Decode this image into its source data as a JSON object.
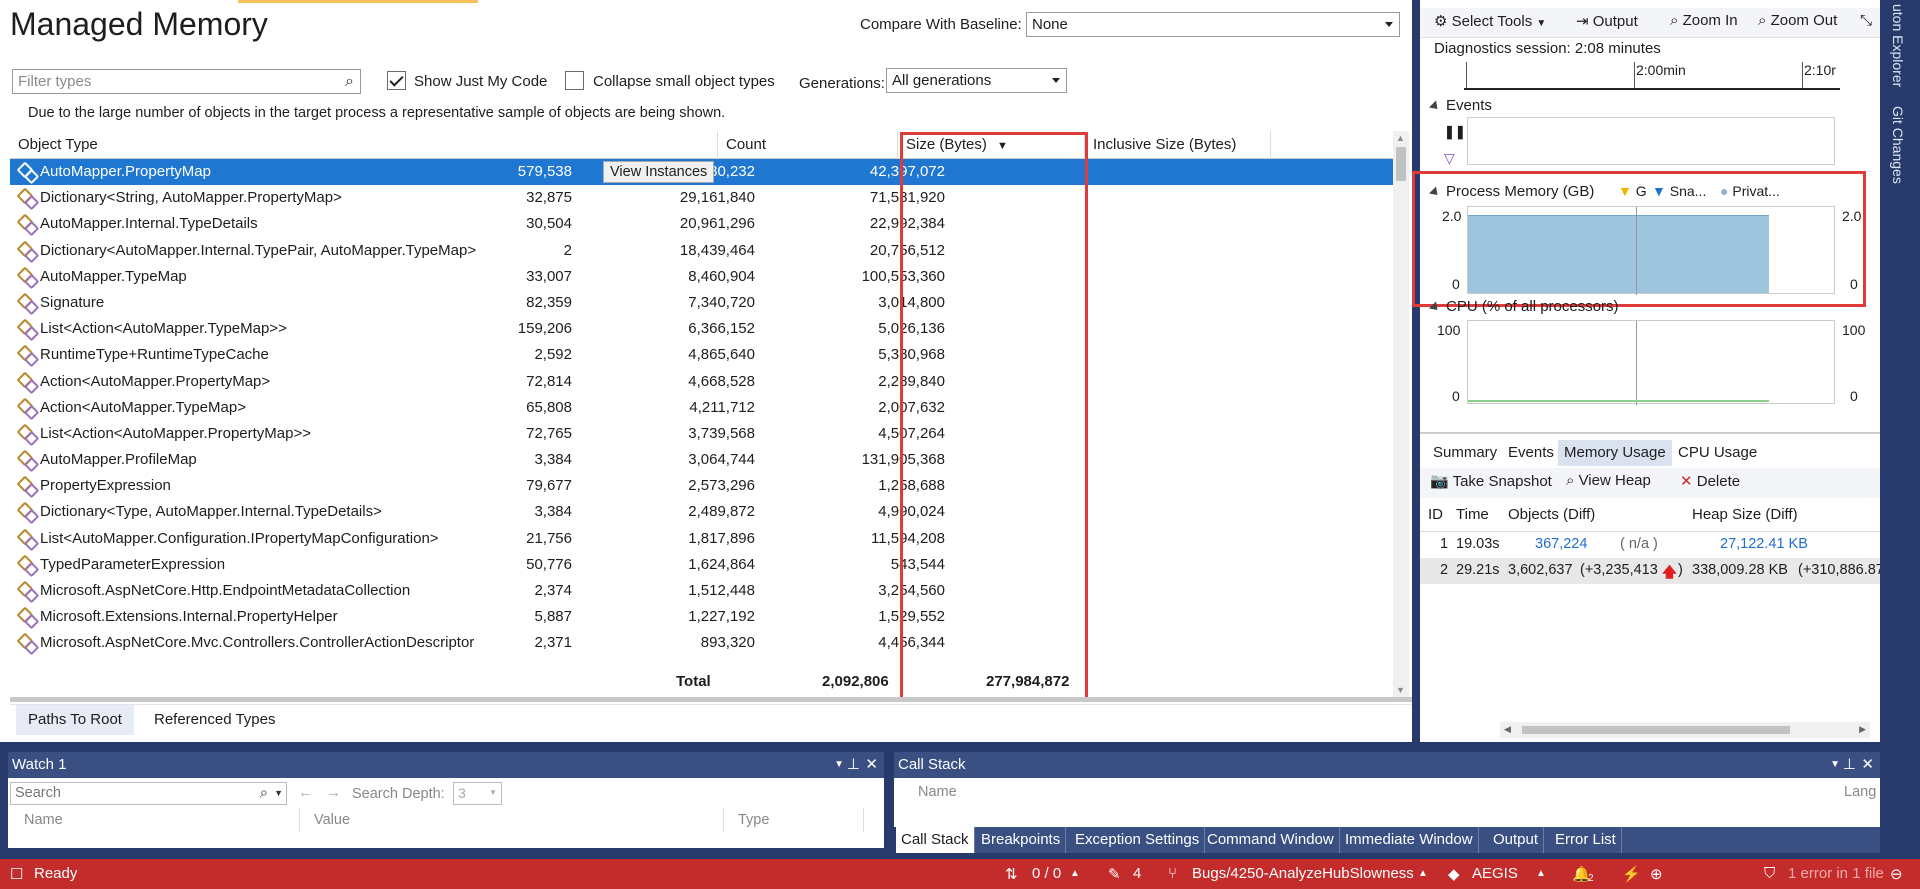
{
  "page": {
    "title": "Managed Memory",
    "compare_label": "Compare With Baseline:",
    "compare_value": "None",
    "filter_placeholder": "Filter types",
    "show_just_my_code": "Show Just My Code",
    "show_just_my_code_checked": true,
    "collapse_small": "Collapse small object types",
    "collapse_small_checked": false,
    "generations_label": "Generations:",
    "generations_value": "All generations",
    "note": "Due to the large number of objects in the target process a representative sample of objects are being shown."
  },
  "grid": {
    "columns": [
      "Object Type",
      "Count",
      "Size (Bytes)",
      "Inclusive Size (Bytes)"
    ],
    "view_instances": "View Instances",
    "rows": [
      {
        "type": "AutoMapper.PropertyMap",
        "count": "579,538",
        "size": "108,280,232",
        "incl": "42,397,072"
      },
      {
        "type": "Dictionary<String, AutoMapper.PropertyMap>",
        "count": "32,875",
        "size": "29,161,840",
        "incl": "71,581,920"
      },
      {
        "type": "AutoMapper.Internal.TypeDetails",
        "count": "30,504",
        "size": "20,961,296",
        "incl": "22,992,384"
      },
      {
        "type": "Dictionary<AutoMapper.Internal.TypePair, AutoMapper.TypeMap>",
        "count": "2",
        "size": "18,439,464",
        "incl": "20,756,512"
      },
      {
        "type": "AutoMapper.TypeMap",
        "count": "33,007",
        "size": "8,460,904",
        "incl": "100,553,360"
      },
      {
        "type": "Signature",
        "count": "82,359",
        "size": "7,340,720",
        "incl": "3,014,800"
      },
      {
        "type": "List<Action<AutoMapper.TypeMap>>",
        "count": "159,206",
        "size": "6,366,152",
        "incl": "5,026,136"
      },
      {
        "type": "RuntimeType+RuntimeTypeCache",
        "count": "2,592",
        "size": "4,865,640",
        "incl": "5,380,968"
      },
      {
        "type": "Action<AutoMapper.PropertyMap>",
        "count": "72,814",
        "size": "4,668,528",
        "incl": "2,289,840"
      },
      {
        "type": "Action<AutoMapper.TypeMap>",
        "count": "65,808",
        "size": "4,211,712",
        "incl": "2,007,632"
      },
      {
        "type": "List<Action<AutoMapper.PropertyMap>>",
        "count": "72,765",
        "size": "3,739,568",
        "incl": "4,507,264"
      },
      {
        "type": "AutoMapper.ProfileMap",
        "count": "3,384",
        "size": "3,064,744",
        "incl": "131,905,368"
      },
      {
        "type": "PropertyExpression",
        "count": "79,677",
        "size": "2,573,296",
        "incl": "1,258,688"
      },
      {
        "type": "Dictionary<Type, AutoMapper.Internal.TypeDetails>",
        "count": "3,384",
        "size": "2,489,872",
        "incl": "4,990,024"
      },
      {
        "type": "List<AutoMapper.Configuration.IPropertyMapConfiguration>",
        "count": "21,756",
        "size": "1,817,896",
        "incl": "11,594,208"
      },
      {
        "type": "TypedParameterExpression",
        "count": "50,776",
        "size": "1,624,864",
        "incl": "543,544"
      },
      {
        "type": "Microsoft.AspNetCore.Http.EndpointMetadataCollection",
        "count": "2,374",
        "size": "1,512,448",
        "incl": "3,254,560"
      },
      {
        "type": "Microsoft.Extensions.Internal.PropertyHelper",
        "count": "5,887",
        "size": "1,227,192",
        "incl": "1,529,552"
      },
      {
        "type": "Microsoft.AspNetCore.Mvc.Controllers.ControllerActionDescriptor",
        "count": "2,371",
        "size": "893,320",
        "incl": "4,456,344"
      }
    ],
    "total_label": "Total",
    "total_count": "2,092,806",
    "total_size": "277,984,872"
  },
  "bottom_tabs": [
    "Paths To Root",
    "Referenced Types"
  ],
  "diag": {
    "toolbar": {
      "select_tools": "Select Tools",
      "output": "Output",
      "zoom_in": "Zoom In",
      "zoom_out": "Zoom Out"
    },
    "session": "Diagnostics session: 2:08 minutes",
    "ruler_labels": [
      "2:00min",
      "2:10r"
    ],
    "events_label": "Events",
    "process_memory_label": "Process Memory (GB)",
    "legend": [
      "G",
      "Sna...",
      "Privat..."
    ],
    "mem_ymax": "2.0",
    "mem_ymin": "0",
    "cpu_label": "CPU (% of all processors)",
    "cpu_ymax": "100",
    "cpu_ymin": "0",
    "tabs": [
      "Summary",
      "Events",
      "Memory Usage",
      "CPU Usage"
    ],
    "snap_toolbar": {
      "take": "Take Snapshot",
      "view": "View Heap",
      "delete": "Delete"
    },
    "snap_columns": [
      "ID",
      "Time",
      "Objects (Diff)",
      "Heap Size (Diff)"
    ],
    "snapshots": [
      {
        "id": "1",
        "time": "19.03s",
        "objects": "367,224",
        "objects_diff": "( n/a )",
        "heap": "27,122.41 KB",
        "heap_diff": ""
      },
      {
        "id": "2",
        "time": "29.21s",
        "objects": "3,602,637",
        "objects_diff": "(+3,235,413",
        "objects_diff_close": ")",
        "heap": "338,009.28 KB",
        "heap_diff": "(+310,886.87"
      }
    ],
    "colors": {
      "memory_fill": "#9ec5de",
      "accent_red": "#e03b3b",
      "link_blue": "#1f6fd0"
    }
  },
  "side_tabs": [
    "uton Explorer",
    "Git Changes"
  ],
  "watch": {
    "title": "Watch 1",
    "search_placeholder": "Search",
    "search_depth_label": "Search Depth:",
    "search_depth_value": "3",
    "columns": [
      "Name",
      "Value",
      "Type"
    ]
  },
  "callstack": {
    "title": "Call Stack",
    "columns": [
      "Name",
      "Lang"
    ],
    "tabs": [
      "Call Stack",
      "Breakpoints",
      "Exception Settings",
      "Command Window",
      "Immediate Window",
      "Output",
      "Error List"
    ]
  },
  "status": {
    "ready": "Ready",
    "updown": "0 / 0",
    "edits": "4",
    "branch": "Bugs/4250-AnalyzeHubSlowness",
    "repo": "AEGIS",
    "notif": "2",
    "errors": "1 error in 1 file"
  }
}
